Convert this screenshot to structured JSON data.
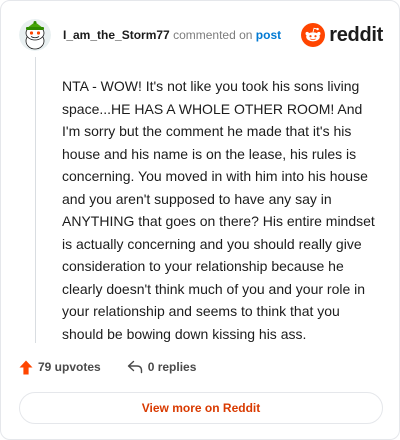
{
  "comment": {
    "author": "I_am_the_Storm77",
    "action_text": "commented on",
    "post_link_text": "post",
    "body": "NTA - WOW! It's not like you took his sons living space...HE HAS A WHOLE OTHER ROOM! And I'm sorry but the comment he made that it's his house and his name is on the lease, his rules is concerning. You moved in with him into his house and you aren't supposed to have any say in ANYTHING that goes on there? His entire mindset is actually concerning and you should really give consideration to your relationship because he clearly doesn't think much of you and your role in your relationship and seems to think that you should be bowing down kissing his ass."
  },
  "brand": {
    "name": "reddit",
    "icon": "reddit-logo-icon",
    "color": "#ff4500"
  },
  "footer": {
    "upvotes_label": "79 upvotes",
    "upvote_icon": "upvote-arrow-icon",
    "replies_label": "0 replies",
    "reply_icon": "reply-arrow-icon"
  },
  "view_more_label": "View more on Reddit",
  "colors": {
    "accent": "#d93a00",
    "link": "#0079d3",
    "upvote": "#ff4500"
  }
}
